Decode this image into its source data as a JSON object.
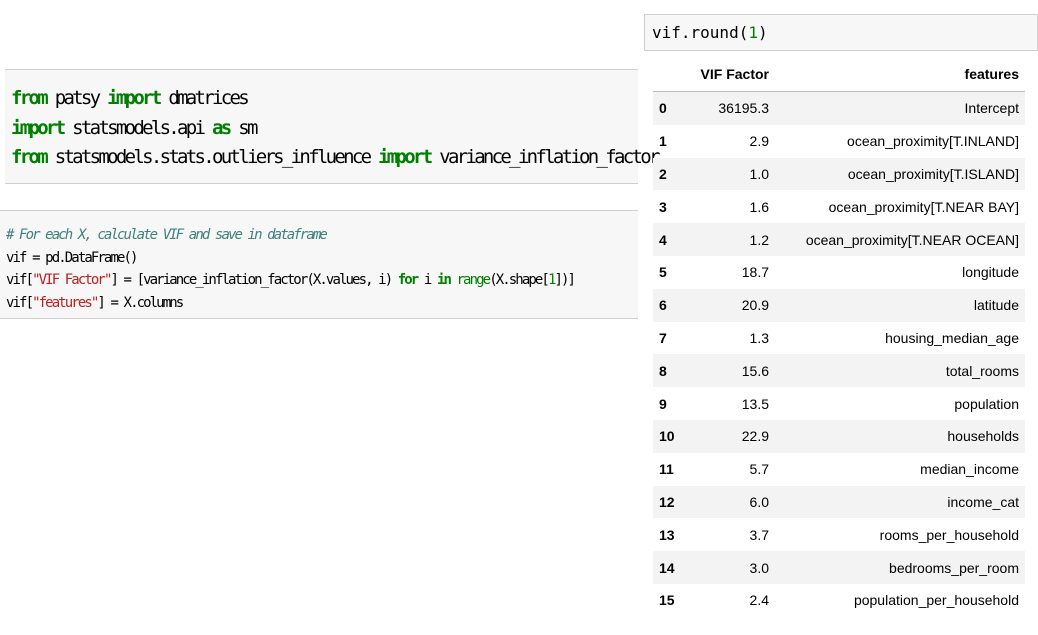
{
  "cell1": {
    "lines": [
      [
        {
          "t": "from",
          "c": "kw"
        },
        {
          "t": " patsy ",
          "c": ""
        },
        {
          "t": "import",
          "c": "kw"
        },
        {
          "t": " dmatrices",
          "c": ""
        }
      ],
      [
        {
          "t": "import",
          "c": "kw"
        },
        {
          "t": " statsmodels.api ",
          "c": ""
        },
        {
          "t": "as",
          "c": "kw"
        },
        {
          "t": " sm",
          "c": ""
        }
      ],
      [
        {
          "t": "from",
          "c": "kw"
        },
        {
          "t": " statsmodels.stats.outliers_influence ",
          "c": ""
        },
        {
          "t": "import",
          "c": "kw"
        },
        {
          "t": " variance_inflation_factor",
          "c": ""
        }
      ]
    ]
  },
  "cell2": {
    "lines": [
      [
        {
          "t": "# For each X, calculate VIF and save in dataframe",
          "c": "cm"
        }
      ],
      [
        {
          "t": "vif = pd.DataFrame()",
          "c": ""
        }
      ],
      [
        {
          "t": "vif[",
          "c": ""
        },
        {
          "t": "\"VIF Factor\"",
          "c": "st"
        },
        {
          "t": "] = [variance_inflation_factor(X.values, i) ",
          "c": ""
        },
        {
          "t": "for",
          "c": "kw"
        },
        {
          "t": " i ",
          "c": ""
        },
        {
          "t": "in",
          "c": "kw"
        },
        {
          "t": " ",
          "c": ""
        },
        {
          "t": "range",
          "c": "nb"
        },
        {
          "t": "(X.shape[",
          "c": ""
        },
        {
          "t": "1",
          "c": "nm"
        },
        {
          "t": "])]",
          "c": ""
        }
      ],
      [
        {
          "t": "vif[",
          "c": ""
        },
        {
          "t": "\"features\"",
          "c": "st"
        },
        {
          "t": "] = X.columns",
          "c": ""
        }
      ]
    ]
  },
  "cell3": {
    "parts": [
      {
        "t": "vif.round(",
        "c": ""
      },
      {
        "t": "1",
        "c": "nm"
      },
      {
        "t": ")",
        "c": ""
      }
    ]
  },
  "table": {
    "headers": [
      "",
      "VIF Factor",
      "features"
    ],
    "rows": [
      {
        "idx": "0",
        "vif": "36195.3",
        "feature": "Intercept"
      },
      {
        "idx": "1",
        "vif": "2.9",
        "feature": "ocean_proximity[T.INLAND]"
      },
      {
        "idx": "2",
        "vif": "1.0",
        "feature": "ocean_proximity[T.ISLAND]"
      },
      {
        "idx": "3",
        "vif": "1.6",
        "feature": "ocean_proximity[T.NEAR BAY]"
      },
      {
        "idx": "4",
        "vif": "1.2",
        "feature": "ocean_proximity[T.NEAR OCEAN]"
      },
      {
        "idx": "5",
        "vif": "18.7",
        "feature": "longitude"
      },
      {
        "idx": "6",
        "vif": "20.9",
        "feature": "latitude"
      },
      {
        "idx": "7",
        "vif": "1.3",
        "feature": "housing_median_age"
      },
      {
        "idx": "8",
        "vif": "15.6",
        "feature": "total_rooms"
      },
      {
        "idx": "9",
        "vif": "13.5",
        "feature": "population"
      },
      {
        "idx": "10",
        "vif": "22.9",
        "feature": "households"
      },
      {
        "idx": "11",
        "vif": "5.7",
        "feature": "median_income"
      },
      {
        "idx": "12",
        "vif": "6.0",
        "feature": "income_cat"
      },
      {
        "idx": "13",
        "vif": "3.7",
        "feature": "rooms_per_household"
      },
      {
        "idx": "14",
        "vif": "3.0",
        "feature": "bedrooms_per_room"
      },
      {
        "idx": "15",
        "vif": "2.4",
        "feature": "population_per_household"
      }
    ]
  },
  "colors": {
    "keyword": "#008000",
    "comment": "#408080",
    "string": "#ba2121",
    "cell_background": "#f7f7f7"
  }
}
